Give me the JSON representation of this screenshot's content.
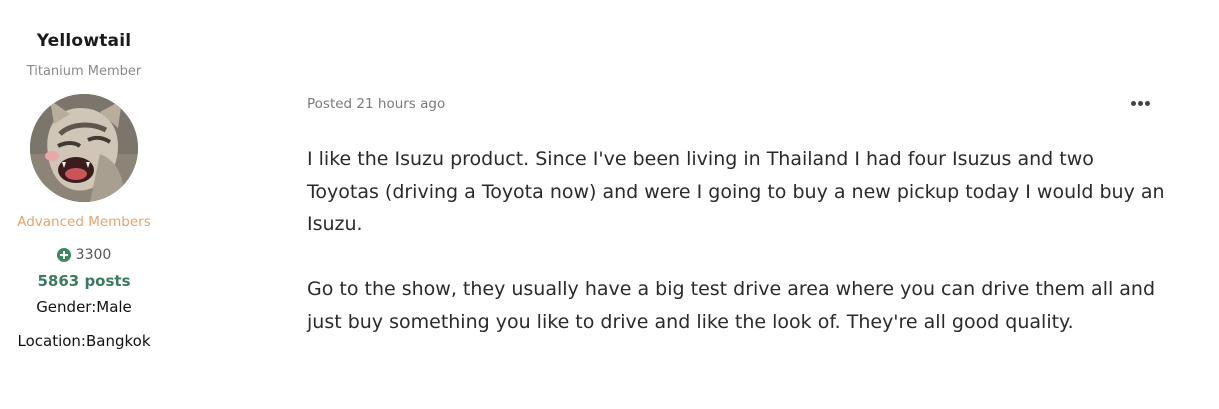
{
  "author": {
    "name": "Yellowtail",
    "title": "Titanium Member",
    "group": "Advanced Members",
    "reputation": "3300",
    "posts": "5863 posts",
    "gender": "Gender:Male",
    "location": "Location:Bangkok",
    "icons": {
      "reputation": "plus-circle-icon",
      "more": "ellipsis-icon"
    },
    "colors": {
      "group": "#e8a36b",
      "posts": "#3d7a62",
      "reputation_icon": "#3c8a5b"
    }
  },
  "post": {
    "meta": "Posted 21 hours ago",
    "paragraphs": [
      "I like the Isuzu product. Since I've been living in Thailand I had four Isuzus and two Toyotas (driving a Toyota now) and were I going to buy a new pickup today I would buy an Isuzu.",
      "Go to the show, they usually have a big test drive area where you can drive them all and just buy something you like to drive and like the look of. They're all good quality."
    ]
  }
}
